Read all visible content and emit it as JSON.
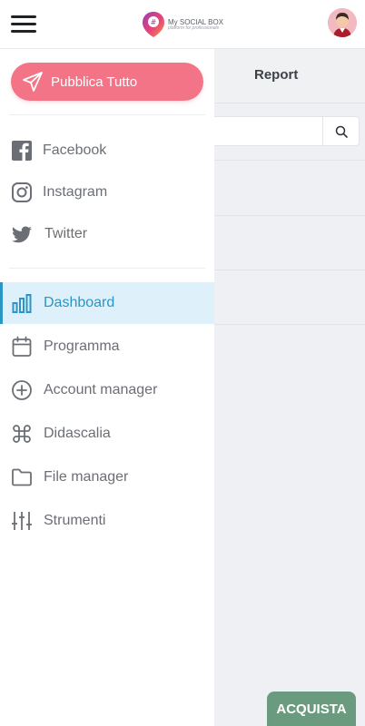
{
  "header": {
    "logo_name": "My SOCIAL BOX",
    "logo_tagline": "platform for professionals"
  },
  "drawer": {
    "publish_label": "Pubblica Tutto",
    "social": [
      {
        "label": "Facebook",
        "icon": "facebook-icon"
      },
      {
        "label": "Instagram",
        "icon": "instagram-icon"
      },
      {
        "label": "Twitter",
        "icon": "twitter-icon"
      }
    ],
    "menu": [
      {
        "label": "Dashboard",
        "icon": "bar-chart-icon",
        "active": true
      },
      {
        "label": "Programma",
        "icon": "calendar-icon"
      },
      {
        "label": "Account manager",
        "icon": "plus-circle-icon"
      },
      {
        "label": "Didascalia",
        "icon": "command-icon"
      },
      {
        "label": "File manager",
        "icon": "folder-icon"
      },
      {
        "label": "Strumenti",
        "icon": "sliders-icon"
      }
    ]
  },
  "background": {
    "tab_report": "Report",
    "buy_button": "ACQUISTA"
  },
  "colors": {
    "accent": "#f47487",
    "active": "#2a95c6",
    "active_bg": "#def1fb",
    "buy": "#6b9b7f"
  }
}
